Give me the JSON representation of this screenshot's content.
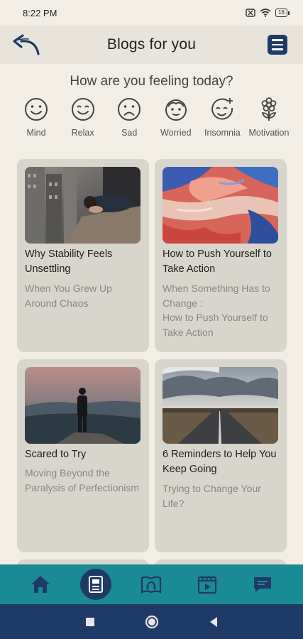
{
  "status": {
    "time": "8:22 PM",
    "battery": "16"
  },
  "header": {
    "title": "Blogs for you"
  },
  "feeling": {
    "question": "How are you feeling today?",
    "moods": [
      {
        "label": "Mind",
        "icon": "smile-face-icon"
      },
      {
        "label": "Relax",
        "icon": "happy-face-icon"
      },
      {
        "label": "Sad",
        "icon": "sad-face-icon"
      },
      {
        "label": "Worried",
        "icon": "worried-face-icon"
      },
      {
        "label": "Insomnia",
        "icon": "insomnia-face-icon"
      },
      {
        "label": "Motivation",
        "icon": "flower-icon"
      }
    ]
  },
  "blogs": [
    {
      "title": "Why Stability Feels Unsettling",
      "subtitle": "When You Grew Up Around Chaos",
      "image": "city-sleeping-person-photo"
    },
    {
      "title": "How to Push Yourself to Take Action",
      "subtitle": "When Something Has to Change :\nHow to Push Yourself to Take Action",
      "image": "abstract-paint-photo"
    },
    {
      "title": "Scared to Try",
      "subtitle": " Moving Beyond the Paralysis of Perfectionism",
      "image": "person-on-cliff-photo"
    },
    {
      "title": "6 Reminders to Help You Keep Going",
      "subtitle": "Trying to Change Your Life?",
      "image": "open-road-photo"
    }
  ],
  "bottom_nav": [
    {
      "name": "home-icon",
      "active": false
    },
    {
      "name": "blogs-icon",
      "active": true
    },
    {
      "name": "audio-book-icon",
      "active": false
    },
    {
      "name": "video-icon",
      "active": false
    },
    {
      "name": "chat-icon",
      "active": false
    }
  ],
  "colors": {
    "accent": "#1a8b95",
    "navy": "#1f3a66",
    "background": "#f2eee5",
    "card": "#d8d5cc"
  }
}
